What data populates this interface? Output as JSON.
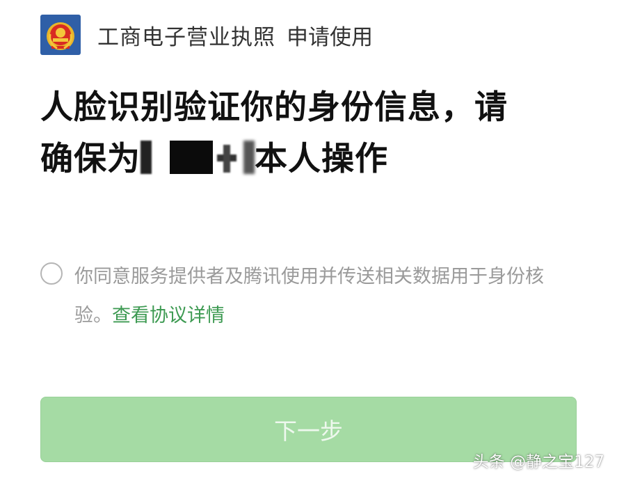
{
  "header": {
    "app_name": "工商电子营业执照",
    "action": "申请使用"
  },
  "headline": {
    "line1": "人脸识别验证你的身份信息，请",
    "line2_prefix": "确保为",
    "line2_suffix": "本人操作"
  },
  "consent": {
    "text": "你同意服务提供者及腾讯使用并传送相关数据用于身份核验。",
    "link": "查看协议详情"
  },
  "next_button": {
    "label": "下一步"
  },
  "watermark": "头条 @静之宝127",
  "colors": {
    "logo_bg": "#2f5fa7",
    "link_green": "#3d9a52",
    "button_bg": "#a5dba4"
  },
  "icons": {
    "logo": "national-emblem-icon"
  }
}
